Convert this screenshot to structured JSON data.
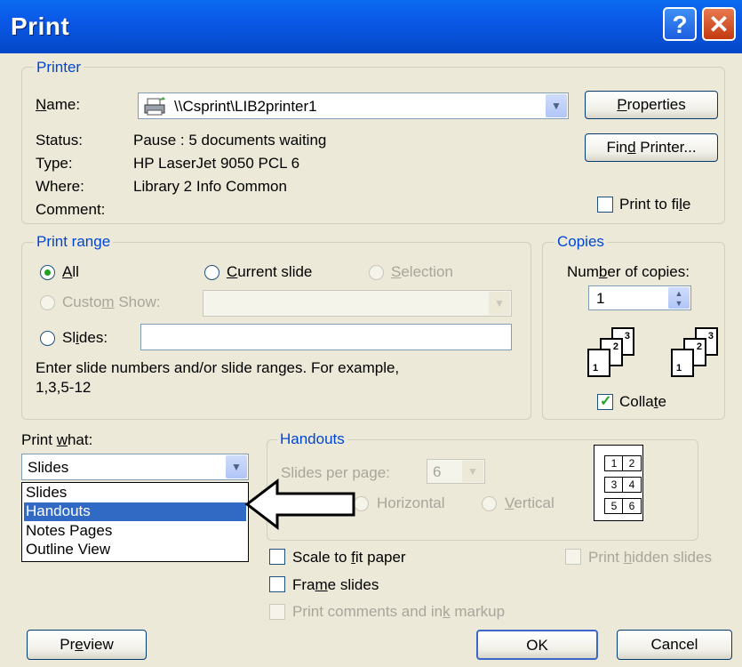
{
  "title": "Print",
  "title_buttons": {
    "help": "?",
    "close": "✕"
  },
  "printer": {
    "legend": "Printer",
    "name_label": "Name:",
    "name_value": "\\\\Csprint\\LIB2printer1",
    "status_label": "Status:",
    "status_value": "Pause : 5 documents waiting",
    "type_label": "Type:",
    "type_value": "HP LaserJet 9050 PCL 6",
    "where_label": "Where:",
    "where_value": "Library 2 Info Common",
    "comment_label": "Comment:",
    "properties_label": "Properties",
    "find_printer_label": "Find Printer...",
    "print_to_file_label": "Print to file",
    "print_to_file_checked": false
  },
  "print_range": {
    "legend": "Print range",
    "all_label": "All",
    "current_slide_label": "Current slide",
    "selection_label": "Selection",
    "custom_show_label": "Custom Show:",
    "slides_label": "Slides:",
    "slides_value": "",
    "hint": "Enter slide numbers and/or slide ranges. For example,",
    "hint_example": "1,3,5-12",
    "selected": "All"
  },
  "copies": {
    "legend": "Copies",
    "number_label": "Number of copies:",
    "number_value": "1",
    "collate_label": "Collate",
    "collate_checked": true,
    "page_numbers": [
      "1",
      "2",
      "3"
    ]
  },
  "print_what": {
    "label": "Print what:",
    "value": "Slides",
    "options": [
      "Slides",
      "Handouts",
      "Notes Pages",
      "Outline View"
    ],
    "highlighted": "Handouts"
  },
  "handouts": {
    "legend": "Handouts",
    "slides_per_page_label": "Slides per page:",
    "slides_per_page_value": "6",
    "horizontal_label": "Horizontal",
    "vertical_label": "Vertical",
    "preview_numbers": [
      "1",
      "2",
      "3",
      "4",
      "5",
      "6"
    ]
  },
  "options": {
    "scale_label": "Scale to fit paper",
    "frame_label": "Frame slides",
    "comments_label": "Print comments and ink markup",
    "hidden_label": "Print hidden slides"
  },
  "buttons": {
    "preview": "Preview",
    "ok": "OK",
    "cancel": "Cancel"
  },
  "colors": {
    "titlebar": "#0a58e6",
    "legend": "#0046d5",
    "face": "#ece9d8",
    "highlight": "#316ac5"
  },
  "icons": [
    "printer-icon",
    "help-icon",
    "close-icon",
    "pointer-arrow-icon"
  ]
}
